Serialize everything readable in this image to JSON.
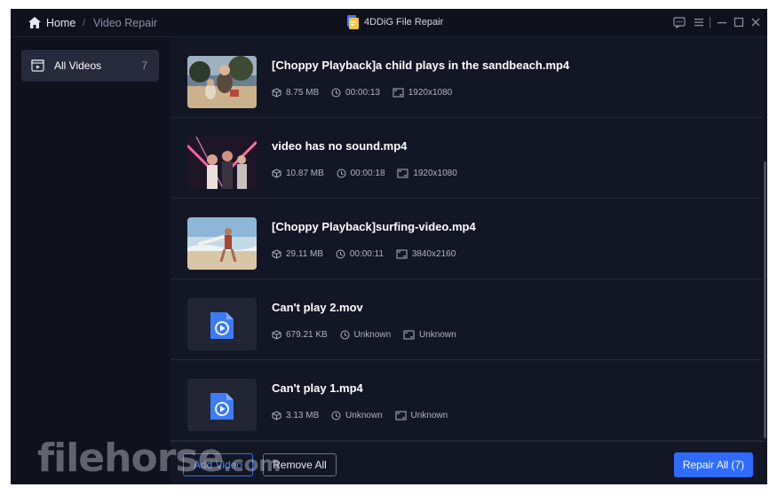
{
  "titlebar": {
    "home_label": "Home",
    "breadcrumb_separator": "/",
    "current_page": "Video Repair",
    "app_title": "4DDiG File Repair",
    "icons": [
      "feedback-icon",
      "menu-icon",
      "minimize-icon",
      "maximize-icon",
      "close-icon"
    ]
  },
  "sidebar": {
    "items": [
      {
        "label": "All Videos",
        "count": "7",
        "icon": "video-folder-icon",
        "selected": true
      }
    ]
  },
  "videos": [
    {
      "title": "[Choppy Playback]a child plays in the sandbeach.mp4",
      "size": "8.75 MB",
      "duration": "00:00:13",
      "resolution": "1920x1080",
      "thumbnail": "beach-photo"
    },
    {
      "title": "video has no sound.mp4",
      "size": "10.87 MB",
      "duration": "00:00:18",
      "resolution": "1920x1080",
      "thumbnail": "party-neon-photo"
    },
    {
      "title": "[Choppy Playback]surfing-video.mp4",
      "size": "29.11 MB",
      "duration": "00:00:11",
      "resolution": "3840x2160",
      "thumbnail": "surfing-photo"
    },
    {
      "title": "Can't play 2.mov",
      "size": "679.21 KB",
      "duration": "Unknown",
      "resolution": "Unknown",
      "thumbnail": "video-file-icon"
    },
    {
      "title": "Can't play 1.mp4",
      "size": "3.13 MB",
      "duration": "Unknown",
      "resolution": "Unknown",
      "thumbnail": "video-file-icon"
    }
  ],
  "footer": {
    "add_label": "Add Video",
    "remove_label": "Remove All",
    "repair_label": "Repair All (7)"
  },
  "watermark": {
    "text": "filehorse",
    "suffix": ".com"
  },
  "colors": {
    "background": "#0f121c",
    "list_background": "#121625",
    "accent": "#2f6bff",
    "selected_item": "#262a3b"
  }
}
